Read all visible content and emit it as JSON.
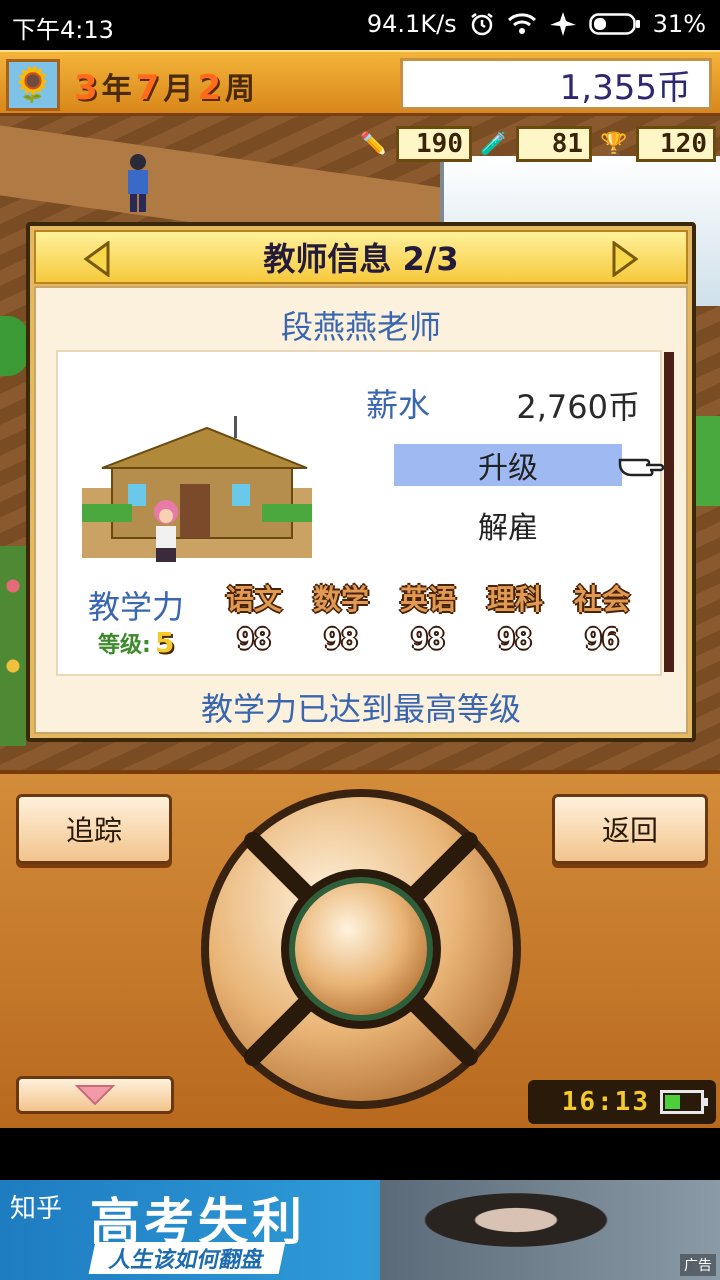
{
  "status_bar": {
    "time": "下午4:13",
    "net_speed": "94.1K/s",
    "battery_percent": "31%",
    "icons": [
      "alarm-icon",
      "wifi-icon",
      "airplane-icon",
      "battery-icon"
    ]
  },
  "game_header": {
    "year": "3",
    "year_unit": "年",
    "month": "7",
    "month_unit": "月",
    "week": "2",
    "week_unit": "周",
    "money": "1,355币"
  },
  "resources": {
    "pencil": "190",
    "flask": "81",
    "trophy": "120"
  },
  "dialog": {
    "title": "教师信息 2/3",
    "teacher_name": "段燕燕老师",
    "salary_label": "薪水",
    "salary_value": "2,760币",
    "upgrade_label": "升级",
    "fire_label": "解雇",
    "teaching_label": "教学力",
    "level_label": "等级:",
    "level_value": "5",
    "subjects": [
      {
        "name": "语文",
        "score": "98"
      },
      {
        "name": "数学",
        "score": "98"
      },
      {
        "name": "英语",
        "score": "98"
      },
      {
        "name": "理科",
        "score": "98"
      },
      {
        "name": "社会",
        "score": "96"
      }
    ],
    "max_note": "教学力已达到最高等级"
  },
  "controller": {
    "track_label": "追踪",
    "back_label": "返回",
    "clock": "16:13",
    "battery_level": 0.4
  },
  "ad": {
    "brand": "知乎",
    "title": "高考失利",
    "subtitle": "人生该如何翻盘",
    "tag": "广告"
  },
  "colors": {
    "accent_blue": "#3a66b0",
    "selection": "#9fb9f3",
    "panel_gold": "#e3b860"
  }
}
